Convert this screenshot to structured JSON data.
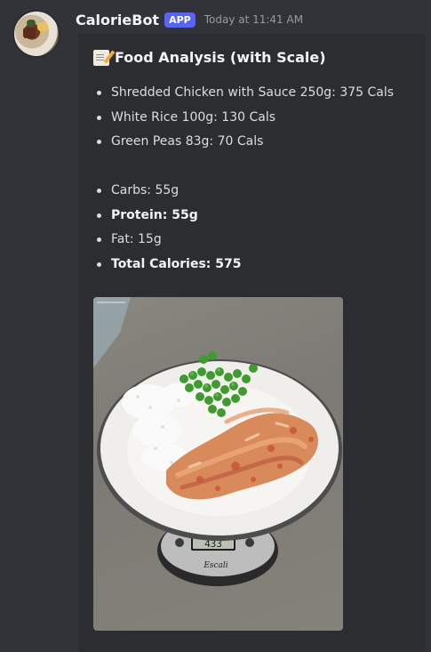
{
  "message": {
    "author": "CalorieBot",
    "badge": "APP",
    "timestamp": "Today at 11:41 AM"
  },
  "embed": {
    "title": "Food Analysis (with Scale)",
    "title_icon": "memo-icon",
    "items": [
      "Shredded Chicken with Sauce 250g: 375 Cals",
      "White Rice 100g: 130 Cals",
      "Green Peas 83g: 70 Cals"
    ],
    "macros": {
      "carbs": "Carbs: 55g",
      "protein": "Protein: 55g",
      "fat": "Fat: 15g",
      "total": "Total Calories: 575"
    },
    "image": {
      "scale_reading": "433",
      "scale_brand": "Escali"
    }
  },
  "colors": {
    "background": "#313338",
    "embed_background": "#2b2d31",
    "badge": "#5865f2",
    "text": "#dbdee1",
    "muted": "#949ba4"
  }
}
